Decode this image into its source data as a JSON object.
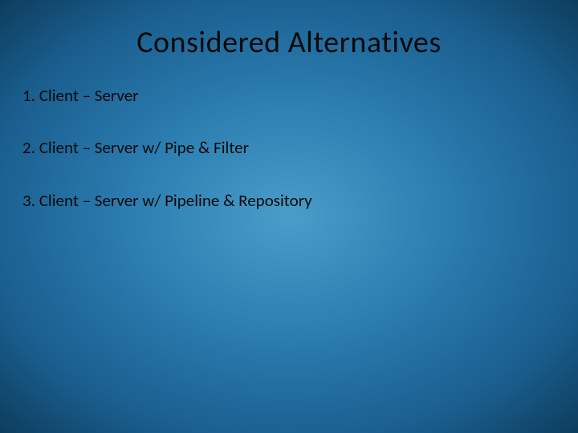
{
  "slide": {
    "title": "Considered Alternatives",
    "items": [
      "1. Client – Server",
      "2. Client – Server w/ Pipe & Filter",
      "3. Client – Server w/ Pipeline & Repository"
    ]
  }
}
